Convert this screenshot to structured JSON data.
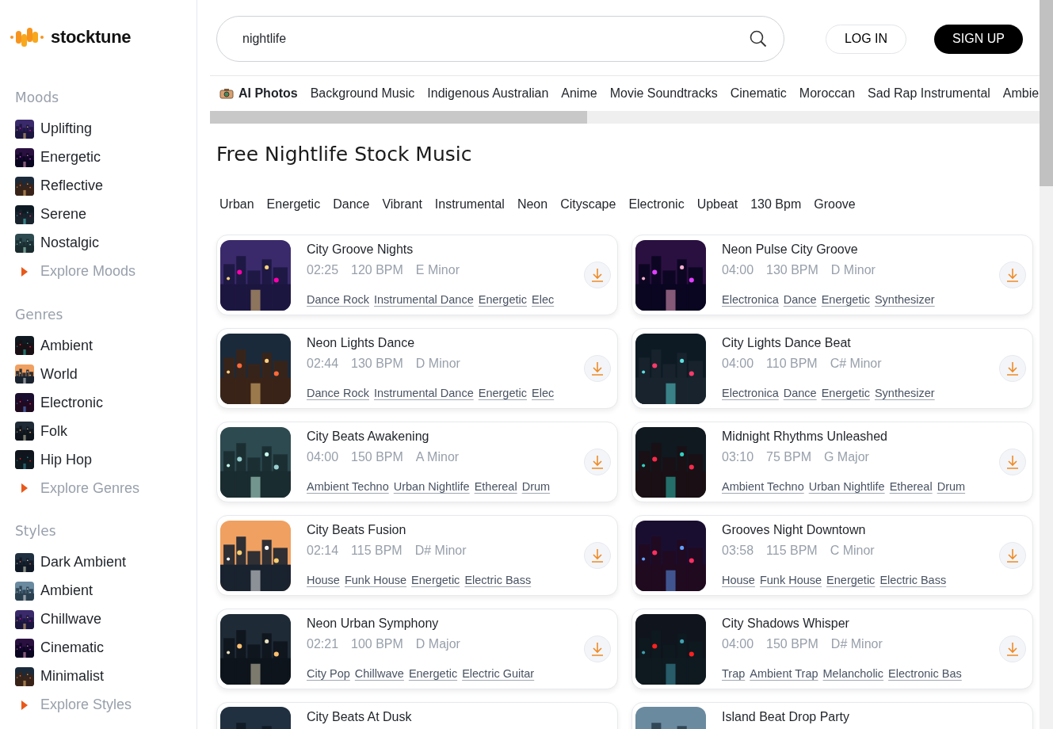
{
  "logo": {
    "text": "stocktune"
  },
  "sidebar": {
    "sections": [
      {
        "heading": "Moods",
        "items": [
          "Uplifting",
          "Energetic",
          "Reflective",
          "Serene",
          "Nostalgic"
        ],
        "explore": "Explore Moods"
      },
      {
        "heading": "Genres",
        "items": [
          "Ambient",
          "World",
          "Electronic",
          "Folk",
          "Hip Hop"
        ],
        "explore": "Explore Genres"
      },
      {
        "heading": "Styles",
        "items": [
          "Dark Ambient",
          "Ambient",
          "Chillwave",
          "Cinematic",
          "Minimalist"
        ],
        "explore": "Explore Styles"
      }
    ]
  },
  "search": {
    "value": "nightlife"
  },
  "auth": {
    "login": "LOG IN",
    "signup": "SIGN UP"
  },
  "categories": [
    {
      "label": "AI Photos",
      "featured": true
    },
    {
      "label": "Background Music",
      "featured": false
    },
    {
      "label": "Indigenous Australian",
      "featured": false
    },
    {
      "label": "Anime",
      "featured": false
    },
    {
      "label": "Movie Soundtracks",
      "featured": false
    },
    {
      "label": "Cinematic",
      "featured": false
    },
    {
      "label": "Moroccan",
      "featured": false
    },
    {
      "label": "Sad Rap Instrumental",
      "featured": false
    },
    {
      "label": "Ambie",
      "featured": false
    }
  ],
  "title": "Free Nightlife Stock Music",
  "tags": [
    "Urban",
    "Energetic",
    "Dance",
    "Vibrant",
    "Instrumental",
    "Neon",
    "Cityscape",
    "Electronic",
    "Upbeat",
    "130 Bpm",
    "Groove"
  ],
  "tracks": [
    {
      "title": "City Groove Nights",
      "duration": "02:25",
      "bpm": "120 BPM",
      "key": "E Minor",
      "tags": [
        "Dance Rock",
        "Instrumental Dance",
        "Energetic",
        "Elec"
      ]
    },
    {
      "title": "Neon Pulse City Groove",
      "duration": "04:00",
      "bpm": "130 BPM",
      "key": "D Minor",
      "tags": [
        "Electronica",
        "Dance",
        "Energetic",
        "Synthesizer"
      ]
    },
    {
      "title": "Neon Lights Dance",
      "duration": "02:44",
      "bpm": "130 BPM",
      "key": "D Minor",
      "tags": [
        "Dance Rock",
        "Instrumental Dance",
        "Energetic",
        "Elec"
      ]
    },
    {
      "title": "City Lights Dance Beat",
      "duration": "04:00",
      "bpm": "110 BPM",
      "key": "C# Minor",
      "tags": [
        "Electronica",
        "Dance",
        "Energetic",
        "Synthesizer"
      ]
    },
    {
      "title": "City Beats Awakening",
      "duration": "04:00",
      "bpm": "150 BPM",
      "key": "A Minor",
      "tags": [
        "Ambient Techno",
        "Urban Nightlife",
        "Ethereal",
        "Drum"
      ]
    },
    {
      "title": "Midnight Rhythms Unleashed",
      "duration": "03:10",
      "bpm": "75 BPM",
      "key": "G Major",
      "tags": [
        "Ambient Techno",
        "Urban Nightlife",
        "Ethereal",
        "Drum"
      ]
    },
    {
      "title": "City Beats Fusion",
      "duration": "02:14",
      "bpm": "115 BPM",
      "key": "D# Minor",
      "tags": [
        "House",
        "Funk House",
        "Energetic",
        "Electric Bass"
      ]
    },
    {
      "title": "Grooves Night Downtown",
      "duration": "03:58",
      "bpm": "115 BPM",
      "key": "C Minor",
      "tags": [
        "House",
        "Funk House",
        "Energetic",
        "Electric Bass"
      ]
    },
    {
      "title": "Neon Urban Symphony",
      "duration": "02:21",
      "bpm": "100 BPM",
      "key": "D Major",
      "tags": [
        "City Pop",
        "Chillwave",
        "Energetic",
        "Electric Guitar"
      ]
    },
    {
      "title": "City Shadows Whisper",
      "duration": "04:00",
      "bpm": "150 BPM",
      "key": "D# Minor",
      "tags": [
        "Trap",
        "Ambient Trap",
        "Melancholic",
        "Electronic Bas"
      ]
    },
    {
      "title": "City Beats At Dusk"
    },
    {
      "title": "Island Beat Drop Party"
    }
  ]
}
